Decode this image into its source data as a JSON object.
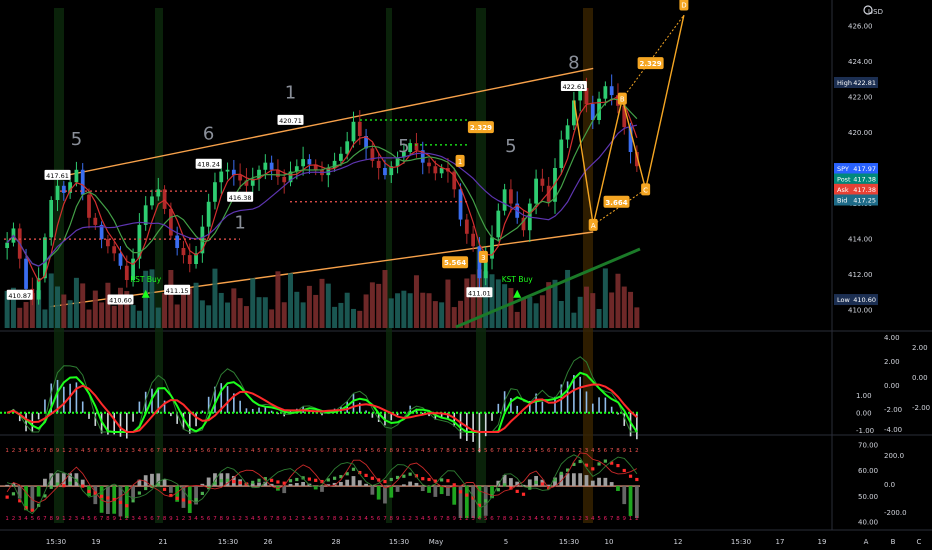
{
  "app": {
    "currency": "USD",
    "toolbar_icon": "cog-icon"
  },
  "colors": {
    "bull": "#26a69a",
    "bear": "#ef5350",
    "candle_up": "#2ecc71",
    "candle_dn": "#e74c3c",
    "fib": "#f5a623",
    "channel": "#f7a14a",
    "kst_green": "#1cff1c",
    "kst_red": "#ff2a2a",
    "badge_blue": "#2962ff",
    "badge_teal": "#00897b",
    "badge_red": "#e84135",
    "badge_steel": "#1e6b88",
    "high_low": "#1c2f52"
  },
  "chart_data": [
    {
      "type": "candlestick",
      "symbol": "SPY",
      "ylim": [
        409,
        427
      ],
      "price_ticks": [
        "426.00",
        "424.00",
        "422.00",
        "420.00",
        "418.00",
        "416.00",
        "414.00",
        "412.00",
        "410.00"
      ],
      "x_ticks": [
        "15:30",
        "19",
        "21",
        "15:30",
        "26",
        "28",
        "15:30",
        "May",
        "5",
        "15:30",
        "10",
        "12",
        "15:30",
        "17",
        "19",
        "A",
        "B",
        "C"
      ],
      "close_series": [
        413.8,
        414.6,
        412.9,
        411.2,
        410.6,
        411.8,
        414.1,
        416.2,
        417.0,
        416.6,
        417.2,
        417.9,
        416.5,
        415.2,
        414.8,
        414.0,
        413.6,
        413.2,
        412.5,
        411.7,
        412.9,
        414.8,
        415.9,
        416.4,
        416.8,
        415.7,
        414.2,
        413.5,
        413.1,
        412.6,
        413.2,
        414.7,
        416.1,
        417.2,
        417.8,
        417.9,
        417.6,
        417.3,
        417.0,
        417.4,
        417.9,
        418.3,
        417.9,
        417.5,
        417.2,
        417.8,
        418.1,
        418.5,
        418.2,
        417.9,
        417.6,
        418.0,
        418.4,
        418.8,
        419.5,
        420.6,
        419.8,
        419.1,
        418.4,
        418.0,
        417.6,
        418.1,
        418.6,
        418.9,
        419.4,
        419.0,
        418.3,
        418.1,
        417.7,
        418.0,
        417.8,
        416.8,
        415.1,
        414.3,
        413.6,
        411.8,
        412.9,
        414.1,
        415.6,
        416.8,
        416.0,
        415.2,
        414.5,
        416.0,
        417.4,
        417.0,
        416.1,
        418.0,
        419.6,
        420.4,
        421.8,
        422.5,
        421.6,
        420.7,
        421.9,
        422.6,
        422.1,
        421.5,
        420.3,
        418.9,
        418.1
      ],
      "price_labels": [
        {
          "text": "410.87",
          "i": 2,
          "price": 410.87
        },
        {
          "text": "417.61",
          "i": 8,
          "price": 417.61
        },
        {
          "text": "410.60",
          "i": 18,
          "price": 410.6
        },
        {
          "text": "411.15",
          "i": 27,
          "price": 411.15
        },
        {
          "text": "418.24",
          "i": 32,
          "price": 418.24
        },
        {
          "text": "416.38",
          "i": 37,
          "price": 416.38
        },
        {
          "text": "420.71",
          "i": 45,
          "price": 420.71
        },
        {
          "text": "411.01",
          "i": 75,
          "price": 411.01
        },
        {
          "text": "422.61",
          "i": 90,
          "price": 422.61
        }
      ],
      "wave_labels": [
        {
          "text": "5",
          "i": 11,
          "price": 419.3
        },
        {
          "text": "6",
          "i": 32,
          "price": 419.6
        },
        {
          "text": "1",
          "i": 37,
          "price": 414.6
        },
        {
          "text": "1",
          "i": 45,
          "price": 421.9
        },
        {
          "text": "5",
          "i": 63,
          "price": 418.9
        },
        {
          "text": "5",
          "i": 80,
          "price": 418.9
        },
        {
          "text": "8",
          "i": 90,
          "price": 423.6
        }
      ],
      "kst_buy": [
        {
          "text": "KST Buy",
          "i": 22,
          "price": 411.6
        },
        {
          "text": "KST Buy",
          "i": 81,
          "price": 411.6
        }
      ],
      "fib_badges": [
        {
          "text": "2.329",
          "price": 420.3,
          "x_ratio": 0.578
        },
        {
          "text": "5.564",
          "price": 412.7,
          "x_ratio": 0.547
        },
        {
          "text": "2.329",
          "price": 423.9,
          "x_ratio": 0.782
        },
        {
          "text": "3.664",
          "price": 416.1,
          "x_ratio": 0.741
        }
      ],
      "letter_badges": [
        {
          "text": "1",
          "price": 418.4,
          "x_ratio": 0.553
        },
        {
          "text": "3",
          "price": 413.0,
          "x_ratio": 0.581
        },
        {
          "text": "A",
          "price": 414.8,
          "x_ratio": 0.713
        },
        {
          "text": "B",
          "price": 421.9,
          "x_ratio": 0.748
        },
        {
          "text": "C",
          "price": 416.8,
          "x_ratio": 0.776
        },
        {
          "text": "D",
          "price": 427.2,
          "x_ratio": 0.822
        }
      ],
      "projection_path": [
        {
          "x_ratio": 0.69,
          "price": 421.8
        },
        {
          "x_ratio": 0.713,
          "price": 414.8
        },
        {
          "x_ratio": 0.748,
          "price": 421.9
        },
        {
          "x_ratio": 0.776,
          "price": 416.8
        },
        {
          "x_ratio": 0.822,
          "price": 426.6
        }
      ],
      "channel_lines": [
        {
          "from": {
            "x_ratio": 0.06,
            "price": 417.4
          },
          "to": {
            "x_ratio": 0.713,
            "price": 423.6
          }
        },
        {
          "from": {
            "x_ratio": 0.06,
            "price": 410.2
          },
          "to": {
            "x_ratio": 0.713,
            "price": 414.4
          }
        }
      ],
      "side_labels": [
        {
          "text": "High",
          "value": "422.81",
          "price": 422.81,
          "color": "high_low"
        },
        {
          "text": "SPY",
          "value": "417.97",
          "price": 417.97,
          "color": "badge_blue"
        },
        {
          "text": "Post",
          "value": "417.38",
          "price": 417.38,
          "color": "badge_teal"
        },
        {
          "text": "Ask",
          "value": "417.38",
          "price": 416.8,
          "color": "badge_red"
        },
        {
          "text": "Bid",
          "value": "417.25",
          "price": 416.2,
          "color": "badge_steel"
        },
        {
          "text": "Low",
          "value": "410.60",
          "price": 410.6,
          "color": "high_low"
        }
      ]
    },
    {
      "type": "line",
      "name": "kst_oscillator",
      "ylim": [
        -1.1,
        4.4
      ],
      "left_ticks": [
        "1.00",
        "0.00",
        "-1.00"
      ],
      "right_ticks": [
        "4.00",
        "2.00",
        "0.00",
        "-2.00",
        "-4.00"
      ],
      "right_ticks_outer": [
        "2.00",
        "0.00",
        "-2.00"
      ]
    },
    {
      "type": "bar",
      "name": "td_sequential_panel",
      "ylim": [
        38,
        72
      ],
      "right_ticks": [
        "70.00",
        "60.00",
        "50.00",
        "40.00"
      ],
      "inner_ticks": [
        "200.0",
        "0.0",
        "-200.0"
      ]
    }
  ]
}
